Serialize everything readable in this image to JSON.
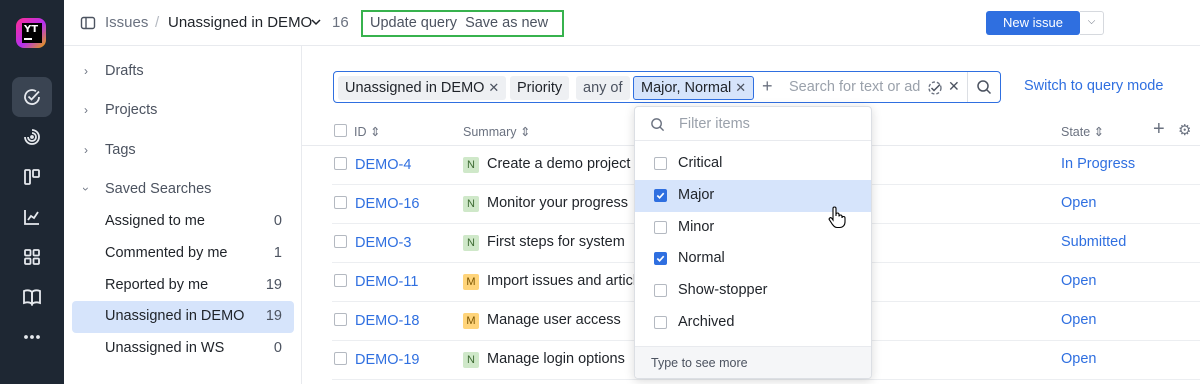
{
  "app": {
    "logo_text": "YT"
  },
  "header": {
    "breadcrumb_root": "Issues",
    "breadcrumb_sep": "/",
    "current_query": "Unassigned in DEMO",
    "count": "16",
    "update_query": "Update query",
    "save_as_new": "Save as new",
    "new_issue": "New issue"
  },
  "sidebar": {
    "sections": [
      {
        "label": "Drafts"
      },
      {
        "label": "Projects"
      },
      {
        "label": "Tags"
      },
      {
        "label": "Saved Searches"
      }
    ],
    "saved": [
      {
        "label": "Assigned to me",
        "count": "0"
      },
      {
        "label": "Commented by me",
        "count": "1"
      },
      {
        "label": "Reported by me",
        "count": "19"
      },
      {
        "label": "Unassigned in DEMO",
        "count": "19"
      },
      {
        "label": "Unassigned in WS",
        "count": "0"
      }
    ]
  },
  "query": {
    "chip1": "Unassigned in DEMO",
    "field": "Priority",
    "op": "any of",
    "values": "Major, Normal",
    "placeholder": "Search for text or ad",
    "switch_mode": "Switch to query mode"
  },
  "table": {
    "headers": {
      "id": "ID",
      "summary": "Summary",
      "state": "State"
    },
    "rows": [
      {
        "id": "DEMO-4",
        "pri": "N",
        "summary": "Create a demo project",
        "state": "In Progress"
      },
      {
        "id": "DEMO-16",
        "pri": "N",
        "summary": "Monitor your progress",
        "state": "Open"
      },
      {
        "id": "DEMO-3",
        "pri": "N",
        "summary": "First steps for system",
        "state": "Submitted"
      },
      {
        "id": "DEMO-11",
        "pri": "M",
        "summary": "Import issues and articles",
        "state": "Open"
      },
      {
        "id": "DEMO-18",
        "pri": "M",
        "summary": "Manage user access",
        "state": "Open"
      },
      {
        "id": "DEMO-19",
        "pri": "N",
        "summary": "Manage login options",
        "state": "Open"
      }
    ]
  },
  "dropdown": {
    "placeholder": "Filter items",
    "items": [
      {
        "label": "Critical",
        "checked": false
      },
      {
        "label": "Major",
        "checked": true
      },
      {
        "label": "Minor",
        "checked": false
      },
      {
        "label": "Normal",
        "checked": true
      },
      {
        "label": "Show-stopper",
        "checked": false
      },
      {
        "label": "Archived",
        "checked": false
      }
    ],
    "footer": "Type to see more"
  },
  "colors": {
    "accent": "#2f6fe0",
    "rail": "#1e2733",
    "highlight": "#d6e4fb",
    "outline": "#37b24d"
  }
}
